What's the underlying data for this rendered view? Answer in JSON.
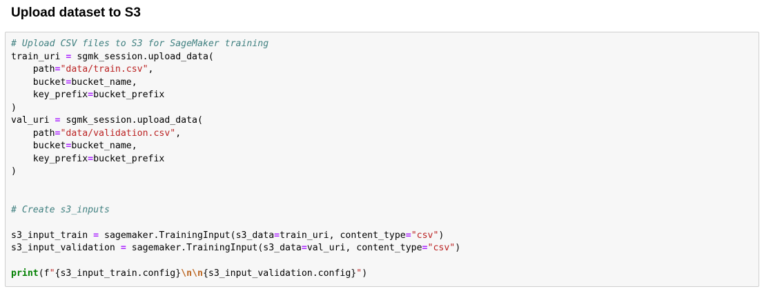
{
  "section_title": "Upload dataset to S3",
  "code": {
    "comment_upload": "# Upload CSV files to S3 for SageMaker training",
    "train_var": "train_uri",
    "eq": "=",
    "session_upload": "sgmk_session.upload_data(",
    "path_kw": "path",
    "train_path": "\"data/train.csv\"",
    "comma": ",",
    "bucket_kw": "bucket",
    "bucket_val": "bucket_name,",
    "prefix_kw": "key_prefix",
    "prefix_val": "bucket_prefix",
    "close_paren": ")",
    "val_var": "val_uri",
    "val_path": "\"data/validation.csv\"",
    "comment_inputs": "# Create s3_inputs",
    "s3_train_var": "s3_input_train",
    "s3_val_var": "s3_input_validation",
    "training_input_call": "sagemaker.TrainingInput(s3_data",
    "train_uri_arg": "train_uri, content_type",
    "val_uri_arg": "val_uri, content_type",
    "csv_str": "\"csv\"",
    "print_kw": "print",
    "print_open": "(f",
    "fstring_open": "\"",
    "train_config": "{s3_input_train.config}",
    "newline_escape": "\\n\\n",
    "val_config": "{s3_input_validation.config}",
    "fstring_close": "\"",
    "indent": "    "
  }
}
